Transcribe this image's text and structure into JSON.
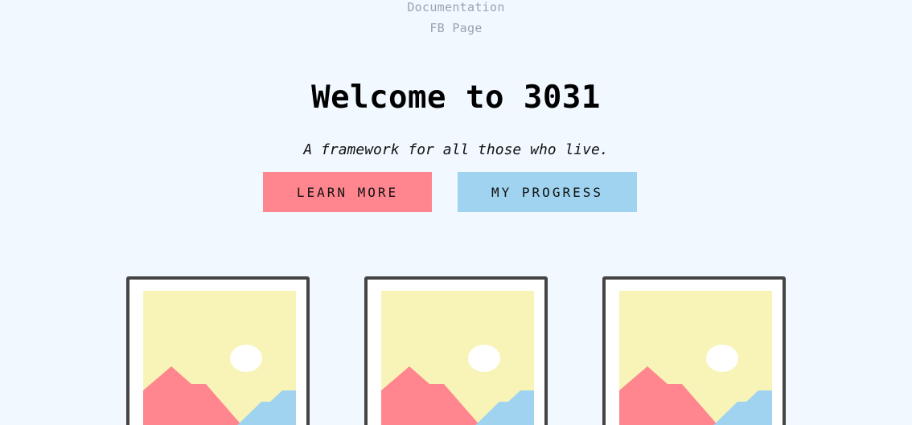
{
  "nav": {
    "links": [
      "Documentation",
      "FB Page"
    ]
  },
  "hero": {
    "title": "Welcome to 3031",
    "subtitle": "A framework for all those who live."
  },
  "buttons": {
    "learn_more": "Learn more",
    "my_progress": "My progress"
  },
  "gallery": {
    "items": [
      {
        "icon": "landscape-image-icon"
      },
      {
        "icon": "landscape-image-icon"
      },
      {
        "icon": "landscape-image-icon"
      }
    ]
  },
  "colors": {
    "background": "#f1f8ff",
    "accent_pink": "#ff868f",
    "accent_blue": "#9fd3ef",
    "sky_yellow": "#f8f4b8",
    "frame_border": "#444444",
    "nav_text": "#9aa3ad"
  }
}
